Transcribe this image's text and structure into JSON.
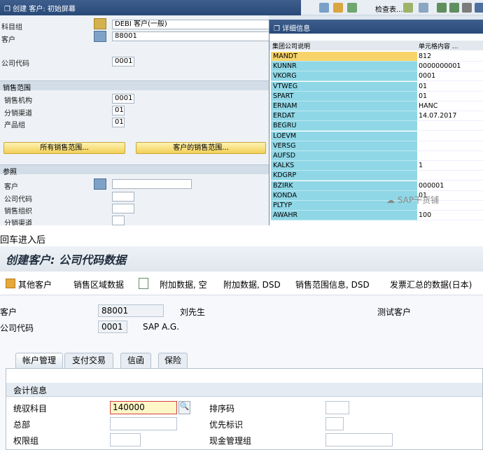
{
  "top": {
    "title": "创建 客户: 初始屏幕",
    "toolbar": {
      "query_label": "检查表..."
    },
    "form": {
      "account_group_label": "科目组",
      "account_group_value": "DEBI 客户(一般)",
      "customer_label": "客户",
      "customer_value": "88001",
      "company_code_label": "公司代码",
      "company_code_value": "0001",
      "sales_area_section": "销售范围",
      "sales_org_label": "销售机构",
      "sales_org_value": "0001",
      "dist_channel_label": "分销渠道",
      "dist_channel_value": "01",
      "division_label": "产品组",
      "division_value": "01",
      "all_sales_areas_button": "所有销售范围...",
      "customer_sales_areas_button": "客户的销售范围...",
      "reference_section": "参照",
      "ref_customer_label": "客户",
      "ref_company_code_label": "公司代码",
      "ref_sales_org_label": "销售组织",
      "ref_dist_channel_label": "分销渠道"
    },
    "popup": {
      "title": "详细信息",
      "col1_header": "集团公司说明",
      "col2_header": "单元格内容 ...",
      "rows": [
        {
          "field": "MANDT",
          "value": "812"
        },
        {
          "field": "KUNNR",
          "value": "0000000001"
        },
        {
          "field": "VKORG",
          "value": "0001"
        },
        {
          "field": "VTWEG",
          "value": "01"
        },
        {
          "field": "SPART",
          "value": "01"
        },
        {
          "field": "ERNAM",
          "value": "HANC"
        },
        {
          "field": "ERDAT",
          "value": "14.07.2017"
        },
        {
          "field": "BEGRU",
          "value": ""
        },
        {
          "field": "LOEVM",
          "value": ""
        },
        {
          "field": "VERSG",
          "value": ""
        },
        {
          "field": "AUFSD",
          "value": ""
        },
        {
          "field": "KALKS",
          "value": "1"
        },
        {
          "field": "KDGRP",
          "value": ""
        },
        {
          "field": "BZIRK",
          "value": "000001"
        },
        {
          "field": "KONDA",
          "value": "01"
        },
        {
          "field": "PLTYP",
          "value": ""
        },
        {
          "field": "AWAHR",
          "value": "100"
        }
      ]
    },
    "watermark": "SAP干货铺"
  },
  "caption": "回车进入后",
  "bottom": {
    "title": "创建客户: 公司代码数据",
    "toolbar": {
      "other_customer": "其他客户",
      "sales_area_data": "销售区域数据",
      "additional_data_empty": "附加数据, 空",
      "additional_data_dsd": "附加数据, DSD",
      "sales_area_info_dsd": "销售范围信息, DSD",
      "invoice_summary_japan": "发票汇总的数据(日本)"
    },
    "header": {
      "customer_label": "客户",
      "customer_value": "88001",
      "customer_name": "刘先生",
      "customer_city": "测试客户",
      "company_code_label": "公司代码",
      "company_code_value": "0001",
      "company_name": "SAP A.G."
    },
    "tabs": [
      "帐户管理",
      "支付交易",
      "信函",
      "保险"
    ],
    "accounting_section": "会计信息",
    "fields": {
      "recon_account_label": "统驭科目",
      "recon_account_value": "140000",
      "sort_key_label": "排序码",
      "head_office_label": "总部",
      "preference_label": "优先标识",
      "auth_group_label": "权限组",
      "cash_mgmt_group_label": "现金管理组"
    }
  }
}
